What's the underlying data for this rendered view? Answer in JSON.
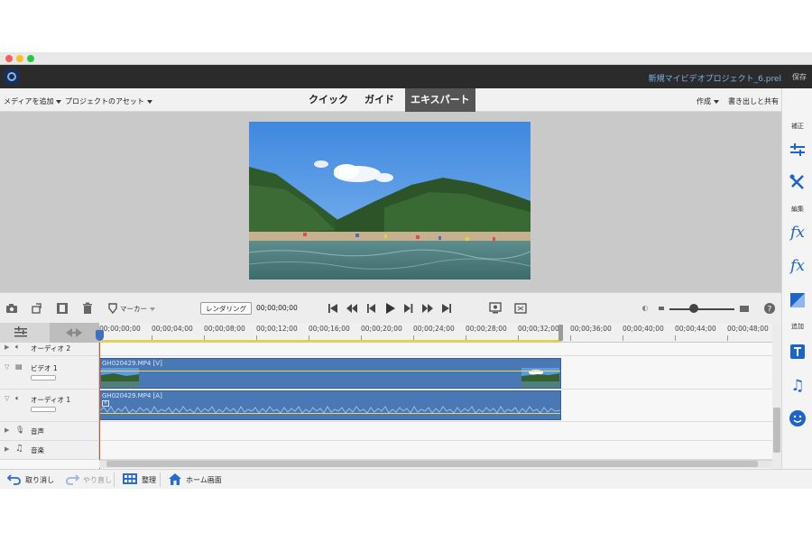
{
  "header": {
    "project_name": "新規マイビデオプロジェクト_6.prel",
    "save_label": "保存"
  },
  "menubar": {
    "add_media": "メディアを追加",
    "project_assets": "プロジェクトのアセット",
    "modes": [
      "クイック",
      "ガイド",
      "エキスパート"
    ],
    "active_mode": "エキスパート",
    "create": "作成",
    "export_share": "書き出しと共有"
  },
  "right_panel": {
    "section_adjust": "補正",
    "section_edit": "編集",
    "section_add": "追加",
    "icons": [
      "adjust-sliders-icon",
      "tools-icon",
      "applied-fx-icon",
      "fx-icon",
      "transitions-icon",
      "text-icon",
      "music-icon",
      "graphics-smiley-icon"
    ]
  },
  "transport": {
    "marker_label": "マーカー",
    "render_label": "レンダリング",
    "timecode": "00;00;00;00"
  },
  "timeline": {
    "ruler_ticks": [
      "00;00;00;00",
      "00;00;04;00",
      "00;00;08;00",
      "00;00;12;00",
      "00;00;16;00",
      "00;00;20;00",
      "00;00;24;00",
      "00;00;28;00",
      "00;00;32;00",
      "00;00;36;00",
      "00;00;40;00",
      "00;00;44;00",
      "00;00;48;00"
    ],
    "tracks": {
      "audio2": "オーディオ 2",
      "video1": "ビデオ 1",
      "audio1": "オーディオ 1",
      "narration": "音声",
      "music": "音楽"
    },
    "clips": {
      "video": "GH020429.MP4 [V]",
      "audio": "GH020429.MP4 [A]"
    }
  },
  "bottombar": {
    "undo": "取り消し",
    "redo": "やり直し",
    "organize": "整理",
    "home_screen": "ホーム画面"
  },
  "colors": {
    "accent": "#1d64c8",
    "clip_fill": "#4a78b5",
    "work_area": "#f1d21a",
    "playhead": "#d9541e"
  }
}
